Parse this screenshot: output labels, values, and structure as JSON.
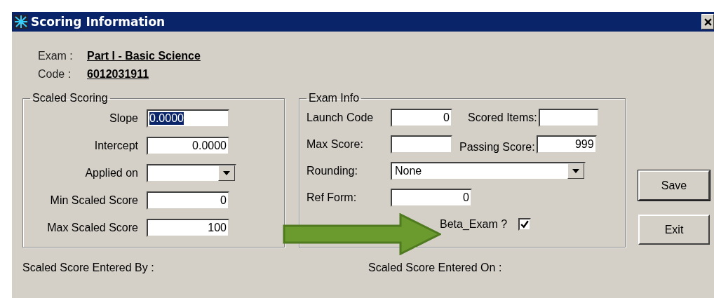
{
  "window": {
    "title": "Scoring Information"
  },
  "header": [
    {
      "label": "Exam :",
      "value": "Part I - Basic Science"
    },
    {
      "label": "Code :",
      "value": "6012031911"
    }
  ],
  "scaled_scoring": {
    "title": "Scaled Scoring",
    "fields": [
      {
        "kind": "text",
        "label": "Slope",
        "value": "0.0000",
        "selected": true
      },
      {
        "kind": "text",
        "label": "Intercept",
        "value": "0.0000",
        "selected": false
      },
      {
        "kind": "dropdown",
        "label": "Applied on",
        "selected": false
      },
      {
        "kind": "text",
        "label": "Min Scaled Score",
        "value": "0",
        "selected": false
      },
      {
        "kind": "text",
        "label": "Max Scaled Score",
        "value": "100",
        "selected": false
      }
    ]
  },
  "exam_info": {
    "title": "Exam Info",
    "rows": [
      [
        {
          "kind": "text",
          "label": "Launch Code",
          "value": "0"
        },
        {
          "kind": "text",
          "label": "Scored Items:"
        }
      ],
      [
        {
          "kind": "text",
          "label": "Max Score:"
        },
        {
          "kind": "text",
          "label": "Passing Score:",
          "value": "999"
        }
      ],
      [
        {
          "kind": "dropdown",
          "label": "Rounding:",
          "value": "None"
        }
      ],
      [
        {
          "kind": "text",
          "label": "Ref Form:",
          "value": "0"
        }
      ],
      [
        {
          "kind": "checkbox",
          "label": "Beta_Exam ?",
          "checked": true
        }
      ]
    ]
  },
  "footer": [
    "Scaled Score Entered By :",
    "Scaled Score Entered On :"
  ],
  "buttons": [
    {
      "label": "Save",
      "default": true
    },
    {
      "label": "Exit",
      "default": false
    }
  ]
}
